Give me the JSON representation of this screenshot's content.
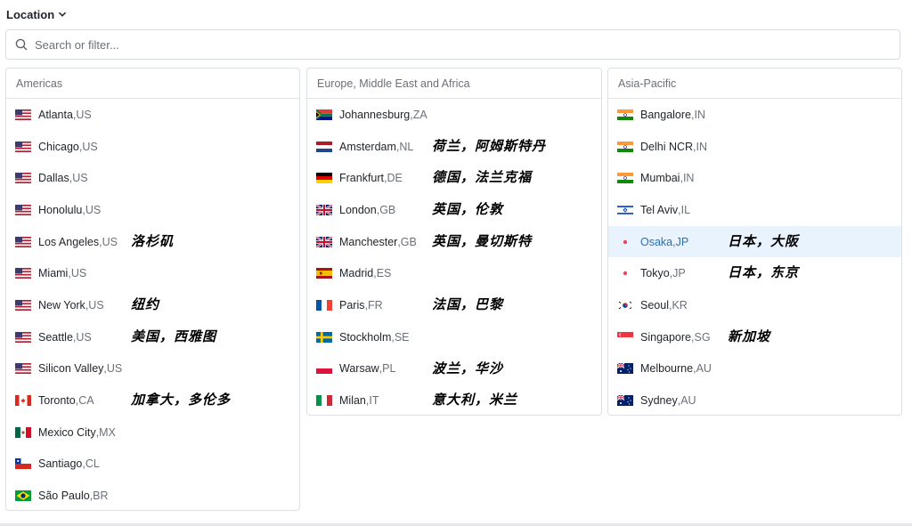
{
  "header": {
    "title": "Location"
  },
  "search": {
    "placeholder": "Search or filter..."
  },
  "regions": [
    {
      "name": "Americas",
      "cities": [
        {
          "city": "Atlanta",
          "code": "US",
          "flag": "us-flag",
          "note": ""
        },
        {
          "city": "Chicago",
          "code": "US",
          "flag": "us-flag",
          "note": ""
        },
        {
          "city": "Dallas",
          "code": "US",
          "flag": "us-flag",
          "note": ""
        },
        {
          "city": "Honolulu",
          "code": "US",
          "flag": "us-flag",
          "note": ""
        },
        {
          "city": "Los Angeles",
          "code": "US",
          "flag": "us-flag",
          "note": "洛杉矶"
        },
        {
          "city": "Miami",
          "code": "US",
          "flag": "us-flag",
          "note": ""
        },
        {
          "city": "New York",
          "code": "US",
          "flag": "us-flag",
          "note": "纽约"
        },
        {
          "city": "Seattle",
          "code": "US",
          "flag": "us-flag",
          "note": "美国，西雅图"
        },
        {
          "city": "Silicon Valley",
          "code": "US",
          "flag": "us-flag",
          "note": ""
        },
        {
          "city": "Toronto",
          "code": "CA",
          "flag": "ca-flag",
          "note": "加拿大，多伦多"
        },
        {
          "city": "Mexico City",
          "code": "MX",
          "flag": "mx-flag",
          "note": ""
        },
        {
          "city": "Santiago",
          "code": "CL",
          "flag": "cl-flag",
          "note": ""
        },
        {
          "city": "São Paulo",
          "code": "BR",
          "flag": "br-flag",
          "note": ""
        }
      ]
    },
    {
      "name": "Europe, Middle East and Africa",
      "cities": [
        {
          "city": "Johannesburg",
          "code": "ZA",
          "flag": "za-flag",
          "note": ""
        },
        {
          "city": "Amsterdam",
          "code": "NL",
          "flag": "nl-flag",
          "note": "荷兰，阿姆斯特丹"
        },
        {
          "city": "Frankfurt",
          "code": "DE",
          "flag": "de-flag",
          "note": "德国，法兰克福"
        },
        {
          "city": "London",
          "code": "GB",
          "flag": "gb-flag",
          "note": "英国，伦敦"
        },
        {
          "city": "Manchester",
          "code": "GB",
          "flag": "gb-flag",
          "note": "英国，曼切斯特"
        },
        {
          "city": "Madrid",
          "code": "ES",
          "flag": "es-flag",
          "note": ""
        },
        {
          "city": "Paris",
          "code": "FR",
          "flag": "fr-flag",
          "note": "法国，巴黎"
        },
        {
          "city": "Stockholm",
          "code": "SE",
          "flag": "se-flag",
          "note": ""
        },
        {
          "city": "Warsaw",
          "code": "PL",
          "flag": "pl-flag",
          "note": "波兰，华沙"
        },
        {
          "city": "Milan",
          "code": "IT",
          "flag": "it-flag",
          "note": "意大利，米兰"
        }
      ]
    },
    {
      "name": "Asia-Pacific",
      "cities": [
        {
          "city": "Bangalore",
          "code": "IN",
          "flag": "in-flag",
          "note": ""
        },
        {
          "city": "Delhi NCR",
          "code": "IN",
          "flag": "in-flag",
          "note": ""
        },
        {
          "city": "Mumbai",
          "code": "IN",
          "flag": "in-flag",
          "note": ""
        },
        {
          "city": "Tel Aviv",
          "code": "IL",
          "flag": "il-flag",
          "note": ""
        },
        {
          "city": "Osaka",
          "code": "JP",
          "flag": "jp-flag",
          "note": "日本，大阪",
          "selected": true
        },
        {
          "city": "Tokyo",
          "code": "JP",
          "flag": "jp-flag",
          "note": "日本，东京"
        },
        {
          "city": "Seoul",
          "code": "KR",
          "flag": "kr-flag",
          "note": ""
        },
        {
          "city": "Singapore",
          "code": "SG",
          "flag": "sg-flag",
          "note": "新加坡"
        },
        {
          "city": "Melbourne",
          "code": "AU",
          "flag": "au-flag",
          "note": ""
        },
        {
          "city": "Sydney",
          "code": "AU",
          "flag": "au-flag",
          "note": ""
        }
      ]
    }
  ]
}
